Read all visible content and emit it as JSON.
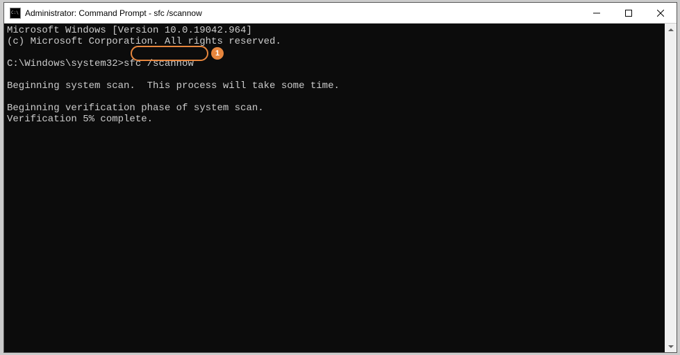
{
  "window": {
    "title": "Administrator: Command Prompt - sfc  /scannow"
  },
  "terminal": {
    "line1": "Microsoft Windows [Version 10.0.19042.964]",
    "line2": "(c) Microsoft Corporation. All rights reserved.",
    "blank1": "",
    "prompt_prefix": "C:\\Windows\\system32>",
    "command": "sfc /scannow",
    "blank2": "",
    "line5": "Beginning system scan.  This process will take some time.",
    "blank3": "",
    "line6": "Beginning verification phase of system scan.",
    "line7": "Verification 5% complete."
  },
  "callout": {
    "number": "1"
  }
}
